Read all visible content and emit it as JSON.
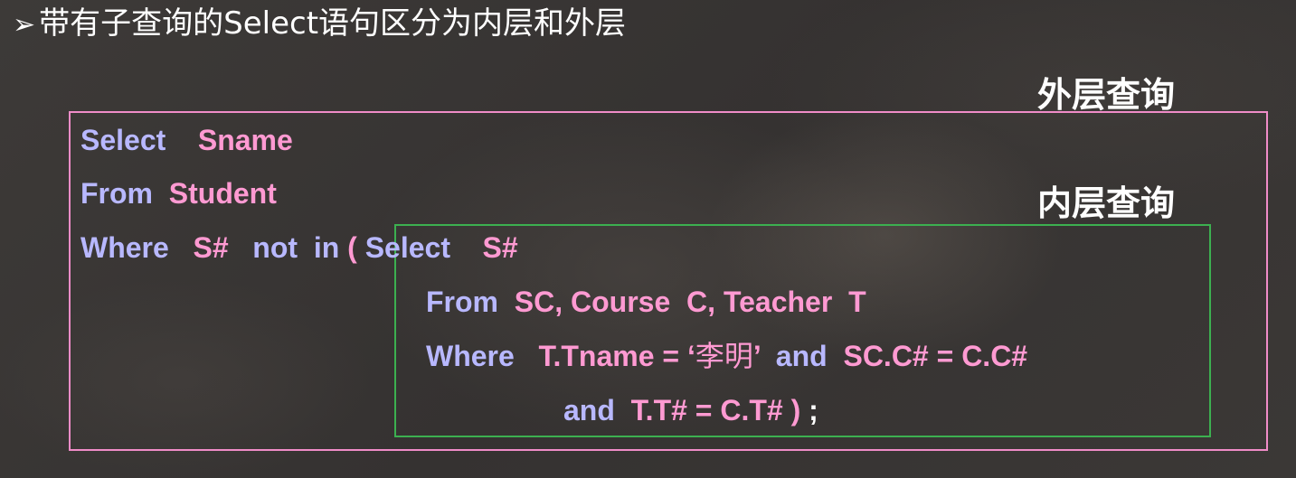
{
  "heading": {
    "bullet": "➢",
    "text": "带有子查询的Select语句区分为内层和外层"
  },
  "labels": {
    "outer": "外层查询",
    "inner": "内层查询"
  },
  "sql": {
    "line1": {
      "kw": "Select",
      "arg": "Sname"
    },
    "line2": {
      "kw": "From",
      "arg": "Student"
    },
    "line3": {
      "kw": "Where",
      "col": "S#",
      "op": "not  in",
      "paren": "(",
      "sub_kw": "Select",
      "sub_col": "S#"
    },
    "line4": {
      "kw": "From",
      "arg": "SC, Course  C, Teacher  T"
    },
    "line5": {
      "kw": "Where",
      "cond1": "T.Tname = ‘",
      "value": "李明",
      "cond1_end": "’",
      "and": "and",
      "cond2": "SC.C# = C.C#"
    },
    "line6": {
      "and": "and",
      "cond": "T.T# = C.T# )",
      "semicolon": ";"
    }
  },
  "colors": {
    "keyword": "#b8b8ff",
    "identifier": "#ff9ad2",
    "outer_box": "#f08cc8",
    "inner_box": "#3cb050",
    "background": "#3a3736"
  }
}
